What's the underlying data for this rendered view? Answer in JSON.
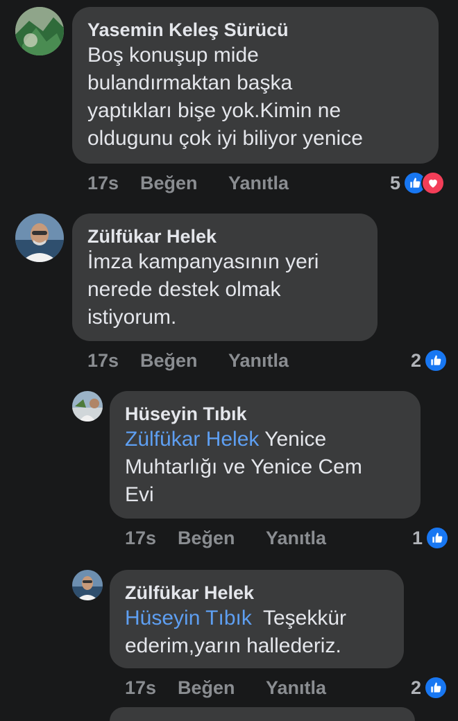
{
  "comments": [
    {
      "author": "Yasemin Keleş Sürücü",
      "lines": [
        "Boş konuşup mide",
        "bulandırmaktan başka",
        "yaptıkları bişe yok.Kimin ne",
        "oldugunu çok iyi biliyor yenice"
      ],
      "time": "17s",
      "like_label": "Beğen",
      "reply_label": "Yanıtla",
      "reaction_count": "5",
      "reactions": [
        "like-icon",
        "love-icon"
      ]
    },
    {
      "author": "Zülfükar Helek",
      "lines": [
        "İmza kampanyasının yeri",
        "nerede destek olmak",
        "istiyorum."
      ],
      "time": "17s",
      "like_label": "Beğen",
      "reply_label": "Yanıtla",
      "reaction_count": "2",
      "reactions": [
        "like-icon"
      ]
    },
    {
      "author": "Hüseyin Tıbık",
      "mention": "Zülfükar Helek",
      "line1_rest": " Yenice",
      "lines": [
        "Muhtarlığı ve Yenice Cem",
        "Evi"
      ],
      "time": "17s",
      "like_label": "Beğen",
      "reply_label": "Yanıtla",
      "reaction_count": "1",
      "reactions": [
        "like-icon"
      ]
    },
    {
      "author": "Zülfükar Helek",
      "mention": "Hüseyin Tıbık",
      "line1_rest": "  Teşekkür",
      "lines": [
        "ederim,yarın hallederiz."
      ],
      "time": "17s",
      "like_label": "Beğen",
      "reply_label": "Yanıtla",
      "reaction_count": "2",
      "reactions": [
        "like-icon"
      ]
    }
  ],
  "colors": {
    "background": "#18191a",
    "bubble": "#3a3b3c",
    "mention": "#5e9ff2",
    "like": "#1877f2",
    "love": "#f33e58"
  }
}
